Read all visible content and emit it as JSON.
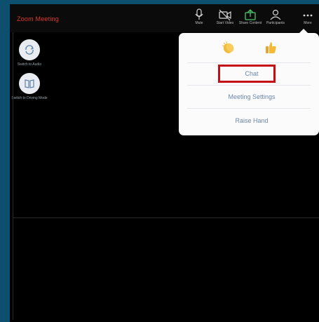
{
  "meeting": {
    "title": "Zoom Meeting"
  },
  "toolbar": {
    "items": [
      {
        "label": "Mute",
        "icon": "microphone-icon"
      },
      {
        "label": "Start Video",
        "icon": "video-camera-icon"
      },
      {
        "label": "Share Content",
        "icon": "share-upload-icon"
      },
      {
        "label": "Participants",
        "icon": "participants-icon"
      },
      {
        "label": "More",
        "icon": "more-dots-icon"
      }
    ]
  },
  "sidebar": {
    "items": [
      {
        "label": "Switch to Audio",
        "icon": "switch-audio-icon"
      },
      {
        "label": "Switch to Driving Mode",
        "icon": "driving-mode-book-icon"
      }
    ]
  },
  "menu": {
    "reactions": [
      {
        "icon": "clapping-hands-icon"
      },
      {
        "icon": "thumbs-up-icon"
      }
    ],
    "items": [
      {
        "label": "Chat",
        "highlighted": true
      },
      {
        "label": "Meeting Settings"
      },
      {
        "label": "Raise Hand"
      }
    ]
  },
  "colors": {
    "background": "#0c4f6e",
    "title": "#e0382d",
    "menu_text": "#6b86a8",
    "highlight": "#c40f17"
  }
}
